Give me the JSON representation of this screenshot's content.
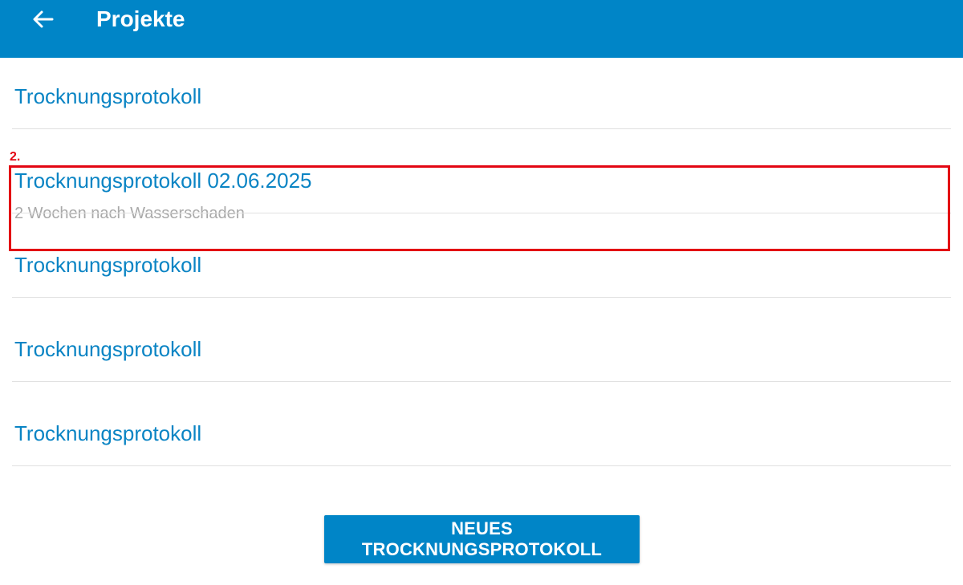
{
  "appbar": {
    "title": "Projekte",
    "back_icon": "arrow-left-icon",
    "background": "#0085c7"
  },
  "list": {
    "items": [
      {
        "title": "Trocknungsprotokoll",
        "subtitle": ""
      },
      {
        "title": "Trocknungsprotokoll 02.06.2025",
        "subtitle": "2 Wochen nach Wasserschaden"
      },
      {
        "title": "Trocknungsprotokoll",
        "subtitle": ""
      },
      {
        "title": "Trocknungsprotokoll",
        "subtitle": ""
      },
      {
        "title": "Trocknungsprotokoll",
        "subtitle": ""
      }
    ],
    "title_color": "#0a84c4",
    "subtitle_color": "#a9a9a9"
  },
  "annotation": {
    "label": "2.",
    "color": "#e30613"
  },
  "actions": {
    "new_protocol_label": "NEUES TROCKNUNGSPROTOKOLL"
  }
}
